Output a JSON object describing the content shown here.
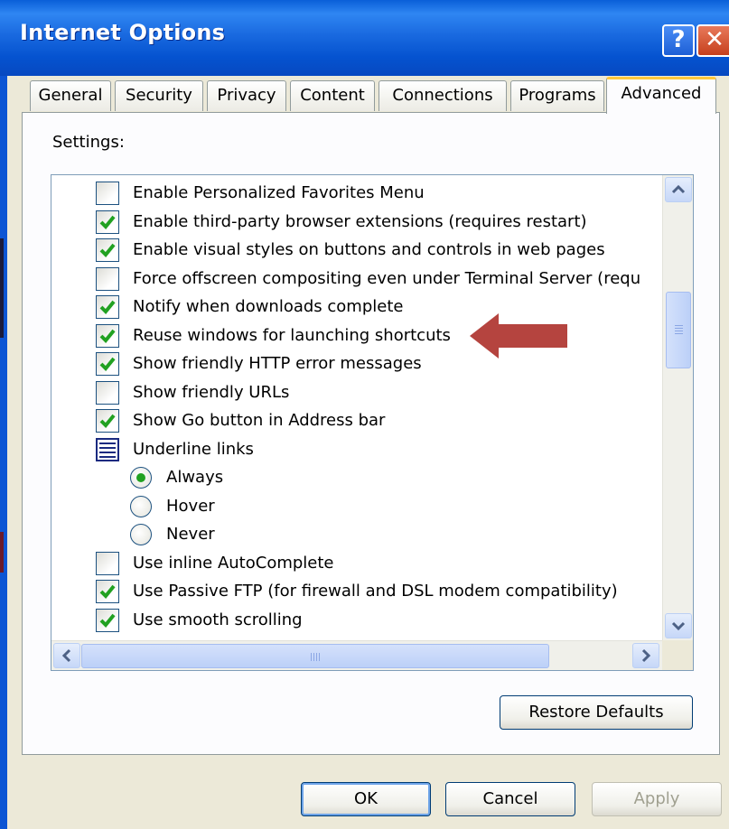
{
  "window": {
    "title": "Internet Options",
    "help_glyph": "?",
    "close_glyph": "✕"
  },
  "tabs": [
    {
      "label": "General"
    },
    {
      "label": "Security"
    },
    {
      "label": "Privacy"
    },
    {
      "label": "Content"
    },
    {
      "label": "Connections"
    },
    {
      "label": "Programs"
    },
    {
      "label": "Advanced",
      "active": true
    }
  ],
  "settings_label": "Settings:",
  "settings": [
    {
      "type": "checkbox",
      "checked": false,
      "label": "Enable Personalized Favorites Menu"
    },
    {
      "type": "checkbox",
      "checked": true,
      "label": "Enable third-party browser extensions (requires restart)"
    },
    {
      "type": "checkbox",
      "checked": true,
      "label": "Enable visual styles on buttons and controls in web pages"
    },
    {
      "type": "checkbox",
      "checked": false,
      "label": "Force offscreen compositing even under Terminal Server (requ"
    },
    {
      "type": "checkbox",
      "checked": true,
      "label": "Notify when downloads complete"
    },
    {
      "type": "checkbox",
      "checked": true,
      "label": "Reuse windows for launching shortcuts"
    },
    {
      "type": "checkbox",
      "checked": true,
      "label": "Show friendly HTTP error messages"
    },
    {
      "type": "checkbox",
      "checked": false,
      "label": "Show friendly URLs"
    },
    {
      "type": "checkbox",
      "checked": true,
      "label": "Show Go button in Address bar"
    },
    {
      "type": "group",
      "label": "Underline links"
    },
    {
      "type": "radio",
      "selected": true,
      "label": "Always"
    },
    {
      "type": "radio",
      "selected": false,
      "label": "Hover"
    },
    {
      "type": "radio",
      "selected": false,
      "label": "Never"
    },
    {
      "type": "checkbox",
      "checked": false,
      "label": "Use inline AutoComplete"
    },
    {
      "type": "checkbox",
      "checked": true,
      "label": "Use Passive FTP (for firewall and DSL modem compatibility)"
    },
    {
      "type": "checkbox",
      "checked": true,
      "label": "Use smooth scrolling"
    }
  ],
  "buttons": {
    "restore_defaults": "Restore Defaults",
    "ok": "OK",
    "cancel": "Cancel",
    "apply": "Apply"
  },
  "colors": {
    "titlebar": "#0553d0",
    "check": "#21a121",
    "annotation_arrow": "#b5443f",
    "active_tab_highlight": "#ffc83c"
  }
}
